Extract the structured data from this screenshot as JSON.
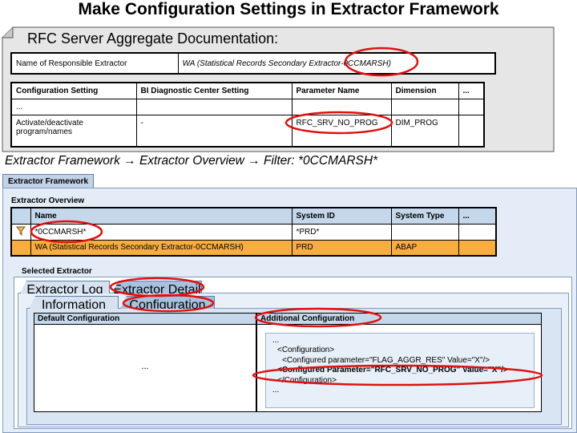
{
  "title": "Make Configuration Settings in Extractor Framework",
  "rfc_doc": {
    "heading": "RFC Server Aggregate Documentation:",
    "responsible": {
      "label": "Name of Responsible Extractor",
      "value": "WA (Statistical Records Secondary Extractor-0CCMARSH)"
    },
    "config_table": {
      "headers": [
        "Configuration Setting",
        "BI Diagnostic Center Setting",
        "Parameter Name",
        "Dimension",
        "..."
      ],
      "rows": [
        [
          "...",
          "",
          "",
          "",
          ""
        ],
        [
          "Activate/deactivate program/names",
          "-",
          "RFC_SRV_NO_PROG",
          "DIM_PROG",
          ""
        ]
      ]
    }
  },
  "nav_path": "Extractor Framework → Extractor Overview → Filter: *0CCMARSH*",
  "sap": {
    "main_tab": "Extractor Framework",
    "overview_label": "Extractor Overview",
    "overview_table": {
      "headers": [
        "",
        "Name",
        "System ID",
        "System Type",
        "..."
      ],
      "filter_row": [
        "*0CCMARSH*",
        "*PRD*",
        "",
        ""
      ],
      "rows": [
        [
          "WA (Statistical Records Secondary Extractor-0CCMARSH)",
          "PRD",
          "ABAP",
          ""
        ]
      ]
    },
    "selected_label": "Selected Extractor",
    "tabs_level1": [
      "Extractor Log",
      "Extractor Detail"
    ],
    "tabs_level2": [
      "Information",
      "Configuration"
    ],
    "default_config": {
      "header": "Default Configuration",
      "content": "..."
    },
    "additional_config": {
      "header": "Additional Configuration",
      "lines": [
        "...",
        "<Configuration>",
        "<Configured parameter=\"FLAG_AGGR_RES\" Value=\"X\"/>",
        "<Configured Parameter=\"RFC_SRV_NO_PROG\" Value=\"X\"/>",
        "</Configuration>",
        "..."
      ]
    }
  },
  "colors": {
    "highlight_oval": "#e01010",
    "selected_row": "#f6ae3f",
    "panel_bg": "#e4edf7",
    "doc_bg": "#e6e6e6"
  },
  "icons": [
    "filter-icon"
  ]
}
